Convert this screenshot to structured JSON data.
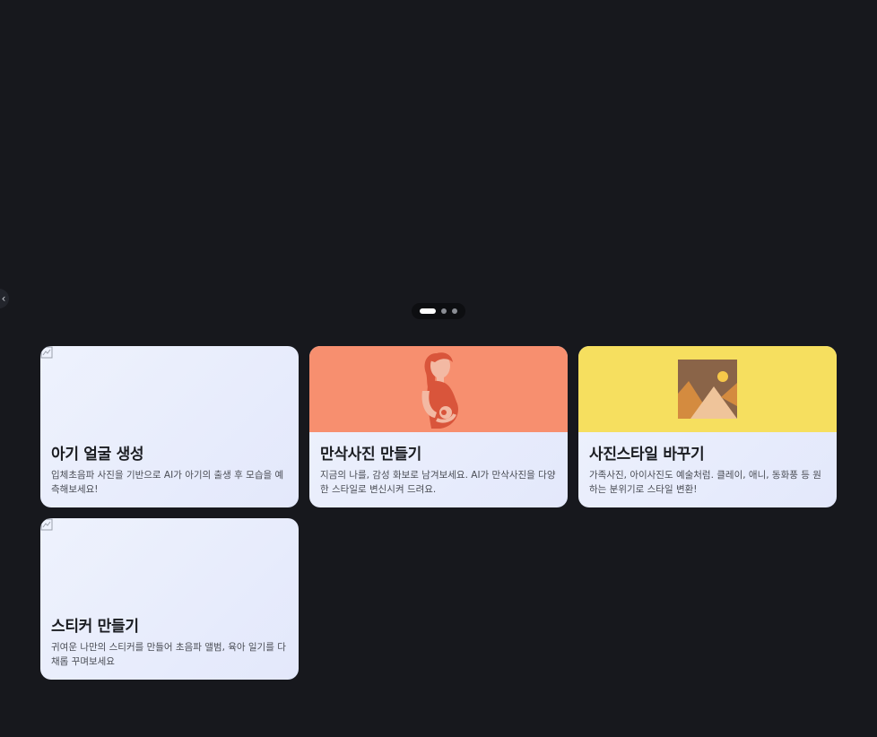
{
  "carousel": {
    "prev_icon_glyph": "‹",
    "slides_count": 3,
    "active_slide": 1
  },
  "cards": [
    {
      "title": "아기 얼굴 생성",
      "description": "입체초음파 사진을 기반으로 AI가 아기의 출생 후 모습을 예측해보세요!",
      "image": "broken-image-icon"
    },
    {
      "title": "만삭사진 만들기",
      "description": "지금의 나를, 감성 화보로 남겨보세요. AI가 만삭사진을 다양한 스타일로 변신시켜 드려요.",
      "image": "pregnant-woman-illustration",
      "accent": "#f78f6f"
    },
    {
      "title": "사진스타일 바꾸기",
      "description": "가족사진, 아이사진도 예술처럼. 클레이, 애니, 동화풍 등 원하는 분위기로 스타일 변환!",
      "image": "landscape-photo-icon",
      "accent": "#f6df5f"
    },
    {
      "title": "스티커 만들기",
      "description": "귀여운 나만의 스티커를 만들어 초음파 앨범, 육아 일기를 다채롭 꾸며보세요",
      "image": "broken-image-icon"
    }
  ],
  "colors": {
    "background": "#17181d",
    "card_bg": "#eaeffc",
    "title": "#1b1d22",
    "desc": "#4a4d55"
  }
}
